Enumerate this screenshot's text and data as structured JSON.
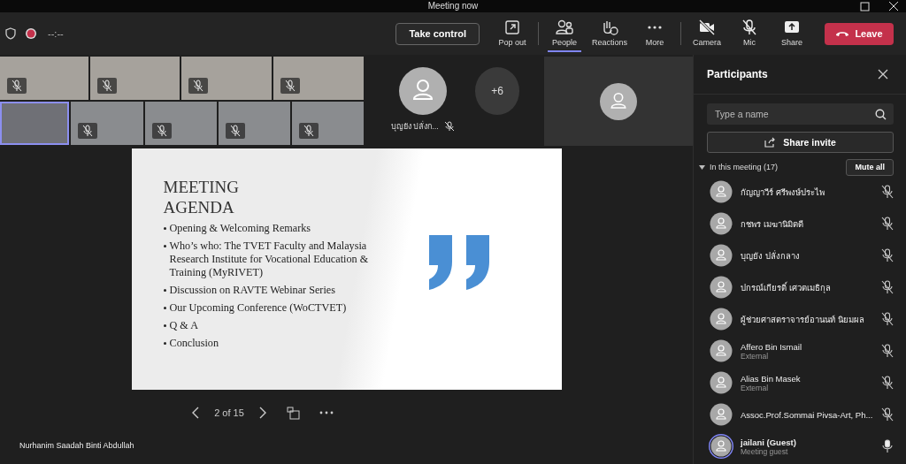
{
  "window": {
    "title": "Meeting now"
  },
  "toolbar": {
    "timer": "--:--",
    "recording": true,
    "take_control": "Take control",
    "pop_out": "Pop out",
    "view_items": [
      {
        "label": "People",
        "selected": true
      },
      {
        "label": "Reactions",
        "selected": false
      },
      {
        "label": "More",
        "selected": false
      }
    ],
    "camera": {
      "label": "Camera",
      "on": false
    },
    "mic": {
      "label": "Mic",
      "on": false
    },
    "share": "Share",
    "leave": "Leave"
  },
  "video_grid": {
    "rows": [
      [
        {
          "muted": true,
          "highlighted": false
        },
        {
          "muted": true,
          "highlighted": false
        },
        {
          "muted": true,
          "highlighted": false
        },
        {
          "muted": true,
          "highlighted": false
        }
      ],
      [
        {
          "muted": false,
          "highlighted": true
        },
        {
          "muted": true,
          "highlighted": false
        },
        {
          "muted": true,
          "highlighted": false
        },
        {
          "muted": true,
          "highlighted": false
        },
        {
          "muted": true,
          "highlighted": false
        }
      ]
    ]
  },
  "avatar_tile": {
    "name": "บุญยัง ปลั่งก...",
    "muted": true
  },
  "overflow_count": "+6",
  "slide": {
    "title": "MEETING AGENDA",
    "bullets": [
      "Opening & Welcoming Remarks",
      "Who’s who: The TVET Faculty and Malaysia Research Institute for Vocational Education & Training (MyRIVET)",
      "Discussion on RAVTE Webinar Series",
      "Our Upcoming Conference (WoCTVET)",
      "Q & A",
      "Conclusion"
    ]
  },
  "slide_nav": {
    "counter": "2 of 15"
  },
  "presenter": "Nurhanim Saadah Binti Abdullah",
  "participants": {
    "title": "Participants",
    "search_placeholder": "Type a name",
    "share_invite": "Share invite",
    "section": "In this meeting (17)",
    "expanded": true,
    "mute_all": "Mute all",
    "items": [
      {
        "name": "กัญญาวีร์ ศรีพงษ์ประไพ",
        "muted": true,
        "speaking": false
      },
      {
        "name": "กชพร เมฆานิมิตดี",
        "muted": true,
        "speaking": false
      },
      {
        "name": "บุญยัง ปลั่งกลาง",
        "muted": true,
        "speaking": false
      },
      {
        "name": "ปกรณ์เกียรติ์ เศวตเมธิกุล",
        "muted": true,
        "speaking": false
      },
      {
        "name": "ผู้ช่วยศาสตราจารย์อานนท์ นิยมผล",
        "muted": true,
        "speaking": false
      },
      {
        "name": "Affero Bin Ismail",
        "subtitle": "External",
        "muted": true,
        "speaking": false
      },
      {
        "name": "Alias Bin Masek",
        "subtitle": "External",
        "muted": true,
        "speaking": false
      },
      {
        "name": "Assoc.Prof.Sommai Pivsa-Art, Ph...",
        "muted": true,
        "speaking": false
      },
      {
        "name": "jailani (Guest)",
        "subtitle": "Meeting guest",
        "muted": false,
        "speaking": true
      }
    ]
  }
}
